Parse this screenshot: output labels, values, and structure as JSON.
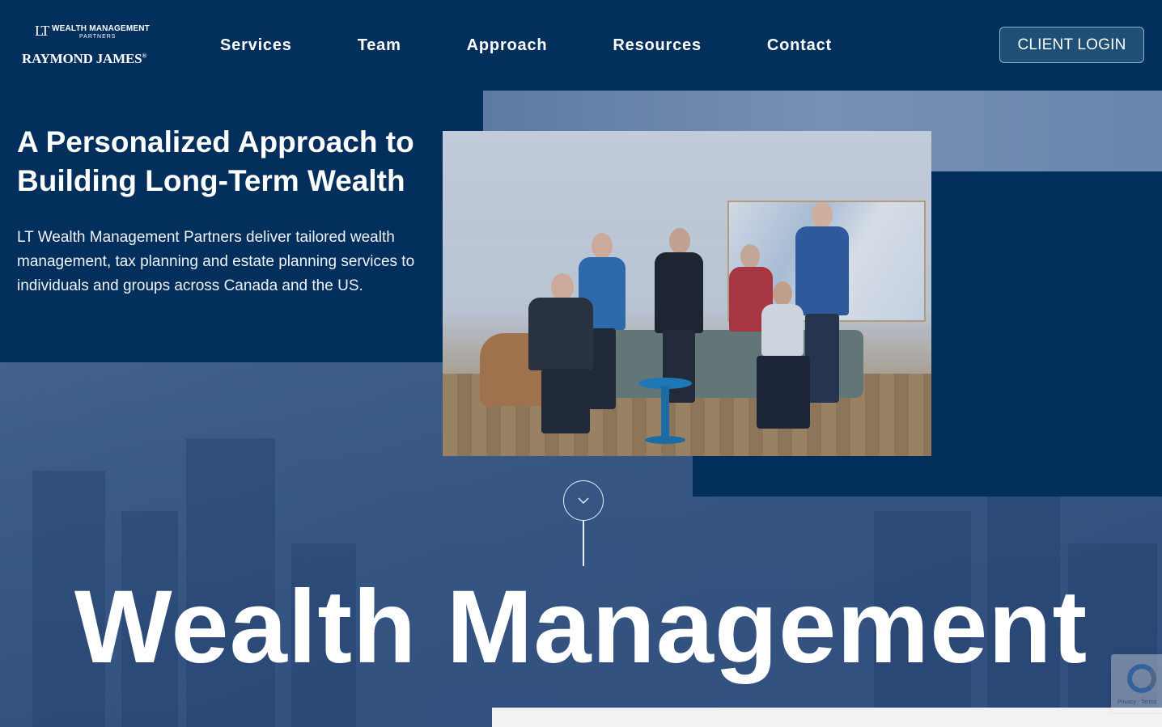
{
  "header": {
    "logo": {
      "mark": "LT",
      "line1": "WEALTH MANAGEMENT",
      "line2": "PARTNERS",
      "brand": "RAYMOND JAMES",
      "brand_mark": "®"
    },
    "nav": [
      {
        "label": "Services"
      },
      {
        "label": "Team"
      },
      {
        "label": "Approach"
      },
      {
        "label": "Resources"
      },
      {
        "label": "Contact"
      }
    ],
    "login_label": "CLIENT LOGIN"
  },
  "hero": {
    "title": "A Personalized Approach to Building Long-Term Wealth",
    "description": "LT Wealth Management Partners deliver tailored wealth management, tax planning and estate planning services to individuals and groups across Canada and the US."
  },
  "section": {
    "heading": "Wealth Management"
  },
  "recaptcha": {
    "text": "Privacy - Terms"
  },
  "colors": {
    "navy": "#032f5d",
    "login_button_bg": "#1f4f74",
    "login_button_border": "#8fb3d6",
    "overlay_blue": "#3a5a86"
  },
  "icons": {
    "scroll": "chevron-down-icon",
    "recaptcha": "recaptcha-icon"
  }
}
